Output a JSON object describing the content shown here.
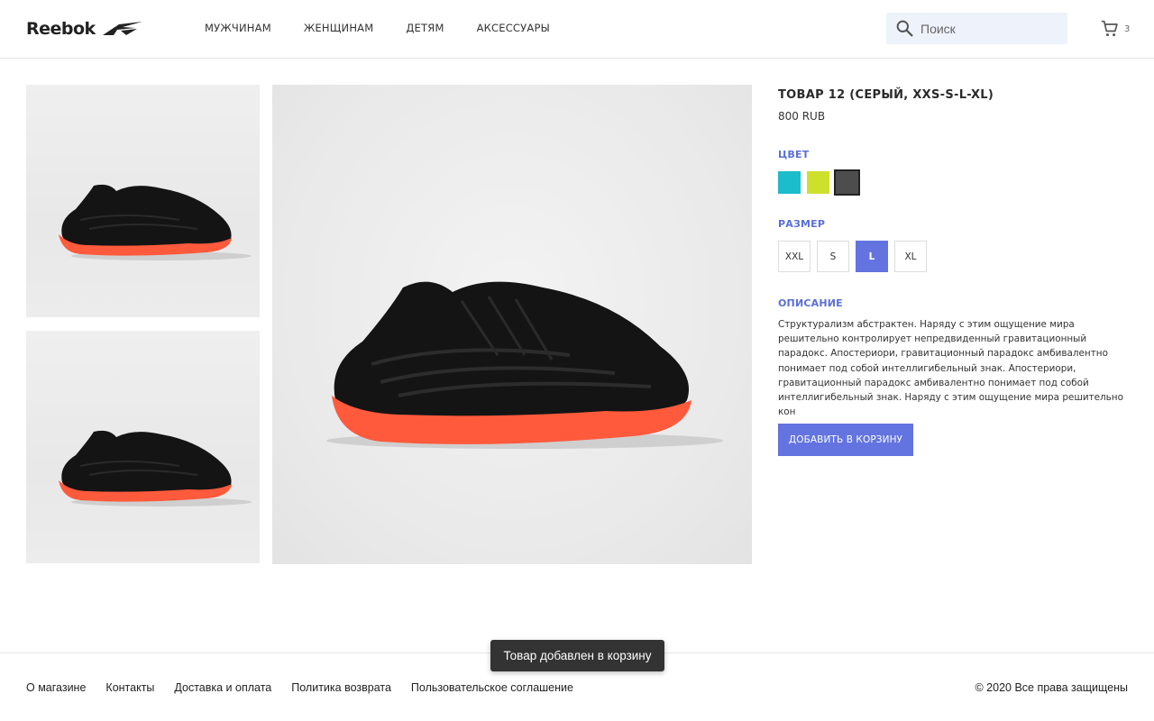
{
  "header": {
    "logo_text": "Reebok",
    "nav": [
      "МУЖЧИНАМ",
      "ЖЕНЩИНАМ",
      "ДЕТЯМ",
      "АКСЕССУАРЫ"
    ],
    "search_placeholder": "Поиск",
    "cart_count": "3"
  },
  "product": {
    "title": "ТОВАР 12 (СЕРЫЙ, XXS-S-L-XL)",
    "price": "800 RUB",
    "color_label": "ЦВЕТ",
    "colors": [
      {
        "name": "teal",
        "hex": "#1bbccb"
      },
      {
        "name": "lime",
        "hex": "#cfe02c"
      },
      {
        "name": "grey",
        "hex": "#4d4d4d"
      }
    ],
    "selected_color": "grey",
    "size_label": "РАЗМЕР",
    "sizes": [
      "XXL",
      "S",
      "L",
      "XL"
    ],
    "selected_size": "L",
    "description_label": "ОПИСАНИЕ",
    "description": "Структурализм абстрактен. Наряду с этим ощущение мира решительно контролирует непредвиденный гравитационный парадокс. Апостериори, гравитационный парадокс амбивалентно понимает под собой интеллигибельный знак. Апостериори, гравитационный парадокс амбивалентно понимает под собой интеллигибельный знак. Наряду с этим ощущение мира решительно кон",
    "add_to_cart": "ДОБАВИТЬ В КОРЗИНУ"
  },
  "toast": "Товар добавлен в корзину",
  "footer": {
    "links": [
      "О магазине",
      "Контакты",
      "Доставка и оплата",
      "Политика возврата",
      "Пользовательское соглашение"
    ],
    "copyright": "© 2020 Все права защищены"
  },
  "colors": {
    "accent": "#6373df",
    "search_bg": "#eef2fb",
    "toast_bg": "#333333"
  }
}
